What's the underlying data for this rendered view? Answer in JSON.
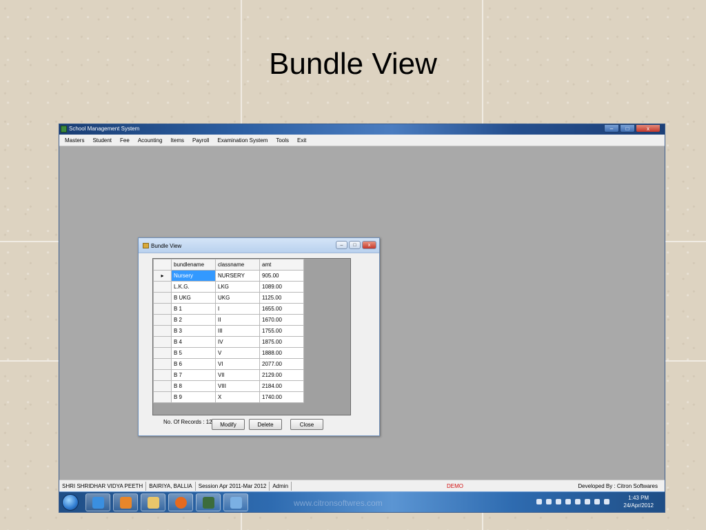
{
  "slide": {
    "title": "Bundle View"
  },
  "app": {
    "title": "School Management System",
    "menu": [
      "Masters",
      "Student",
      "Fee",
      "Acounting",
      "Items",
      "Payroll",
      "Examination System",
      "Tools",
      "Exit"
    ],
    "status": {
      "school": "SHRI SHRIDHAR VIDYA PEETH",
      "location": "BAIRIYA, BALLIA",
      "session": "Session Apr 2011-Mar 2012",
      "user": "Admin",
      "mode": "DEMO",
      "developer": "Developed By : Citron Softwares"
    },
    "window_controls": {
      "minimize": "–",
      "maximize": "□",
      "close": "x"
    }
  },
  "dialog": {
    "title": "Bundle View",
    "controls": {
      "minimize": "–",
      "maximize": "□",
      "close": "x"
    },
    "columns": [
      "bundlename",
      "classname",
      "amt"
    ],
    "rows": [
      [
        "Nursery",
        "NURSERY",
        "905.00"
      ],
      [
        "L.K.G.",
        "LKG",
        "1089.00"
      ],
      [
        "B UKG",
        "UKG",
        "1125.00"
      ],
      [
        "B 1",
        "I",
        "1655.00"
      ],
      [
        "B 2",
        "II",
        "1670.00"
      ],
      [
        "B 3",
        "III",
        "1755.00"
      ],
      [
        "B 4",
        "IV",
        "1875.00"
      ],
      [
        "B 5",
        "V",
        "1888.00"
      ],
      [
        "B 6",
        "VI",
        "2077.00"
      ],
      [
        "B 7",
        "VII",
        "2129.00"
      ],
      [
        "B 8",
        "VIII",
        "2184.00"
      ],
      [
        "B 9",
        "X",
        "1740.00"
      ]
    ],
    "row_indicator": "▸",
    "records_label": "No. Of Records : 12",
    "buttons": {
      "modify": "Modify",
      "delete": "Delete",
      "close": "Close"
    }
  },
  "taskbar": {
    "watermark": "www.citronsoftwres.com",
    "clock_time": "1:43 PM",
    "clock_date": "24/Apr/2012"
  }
}
